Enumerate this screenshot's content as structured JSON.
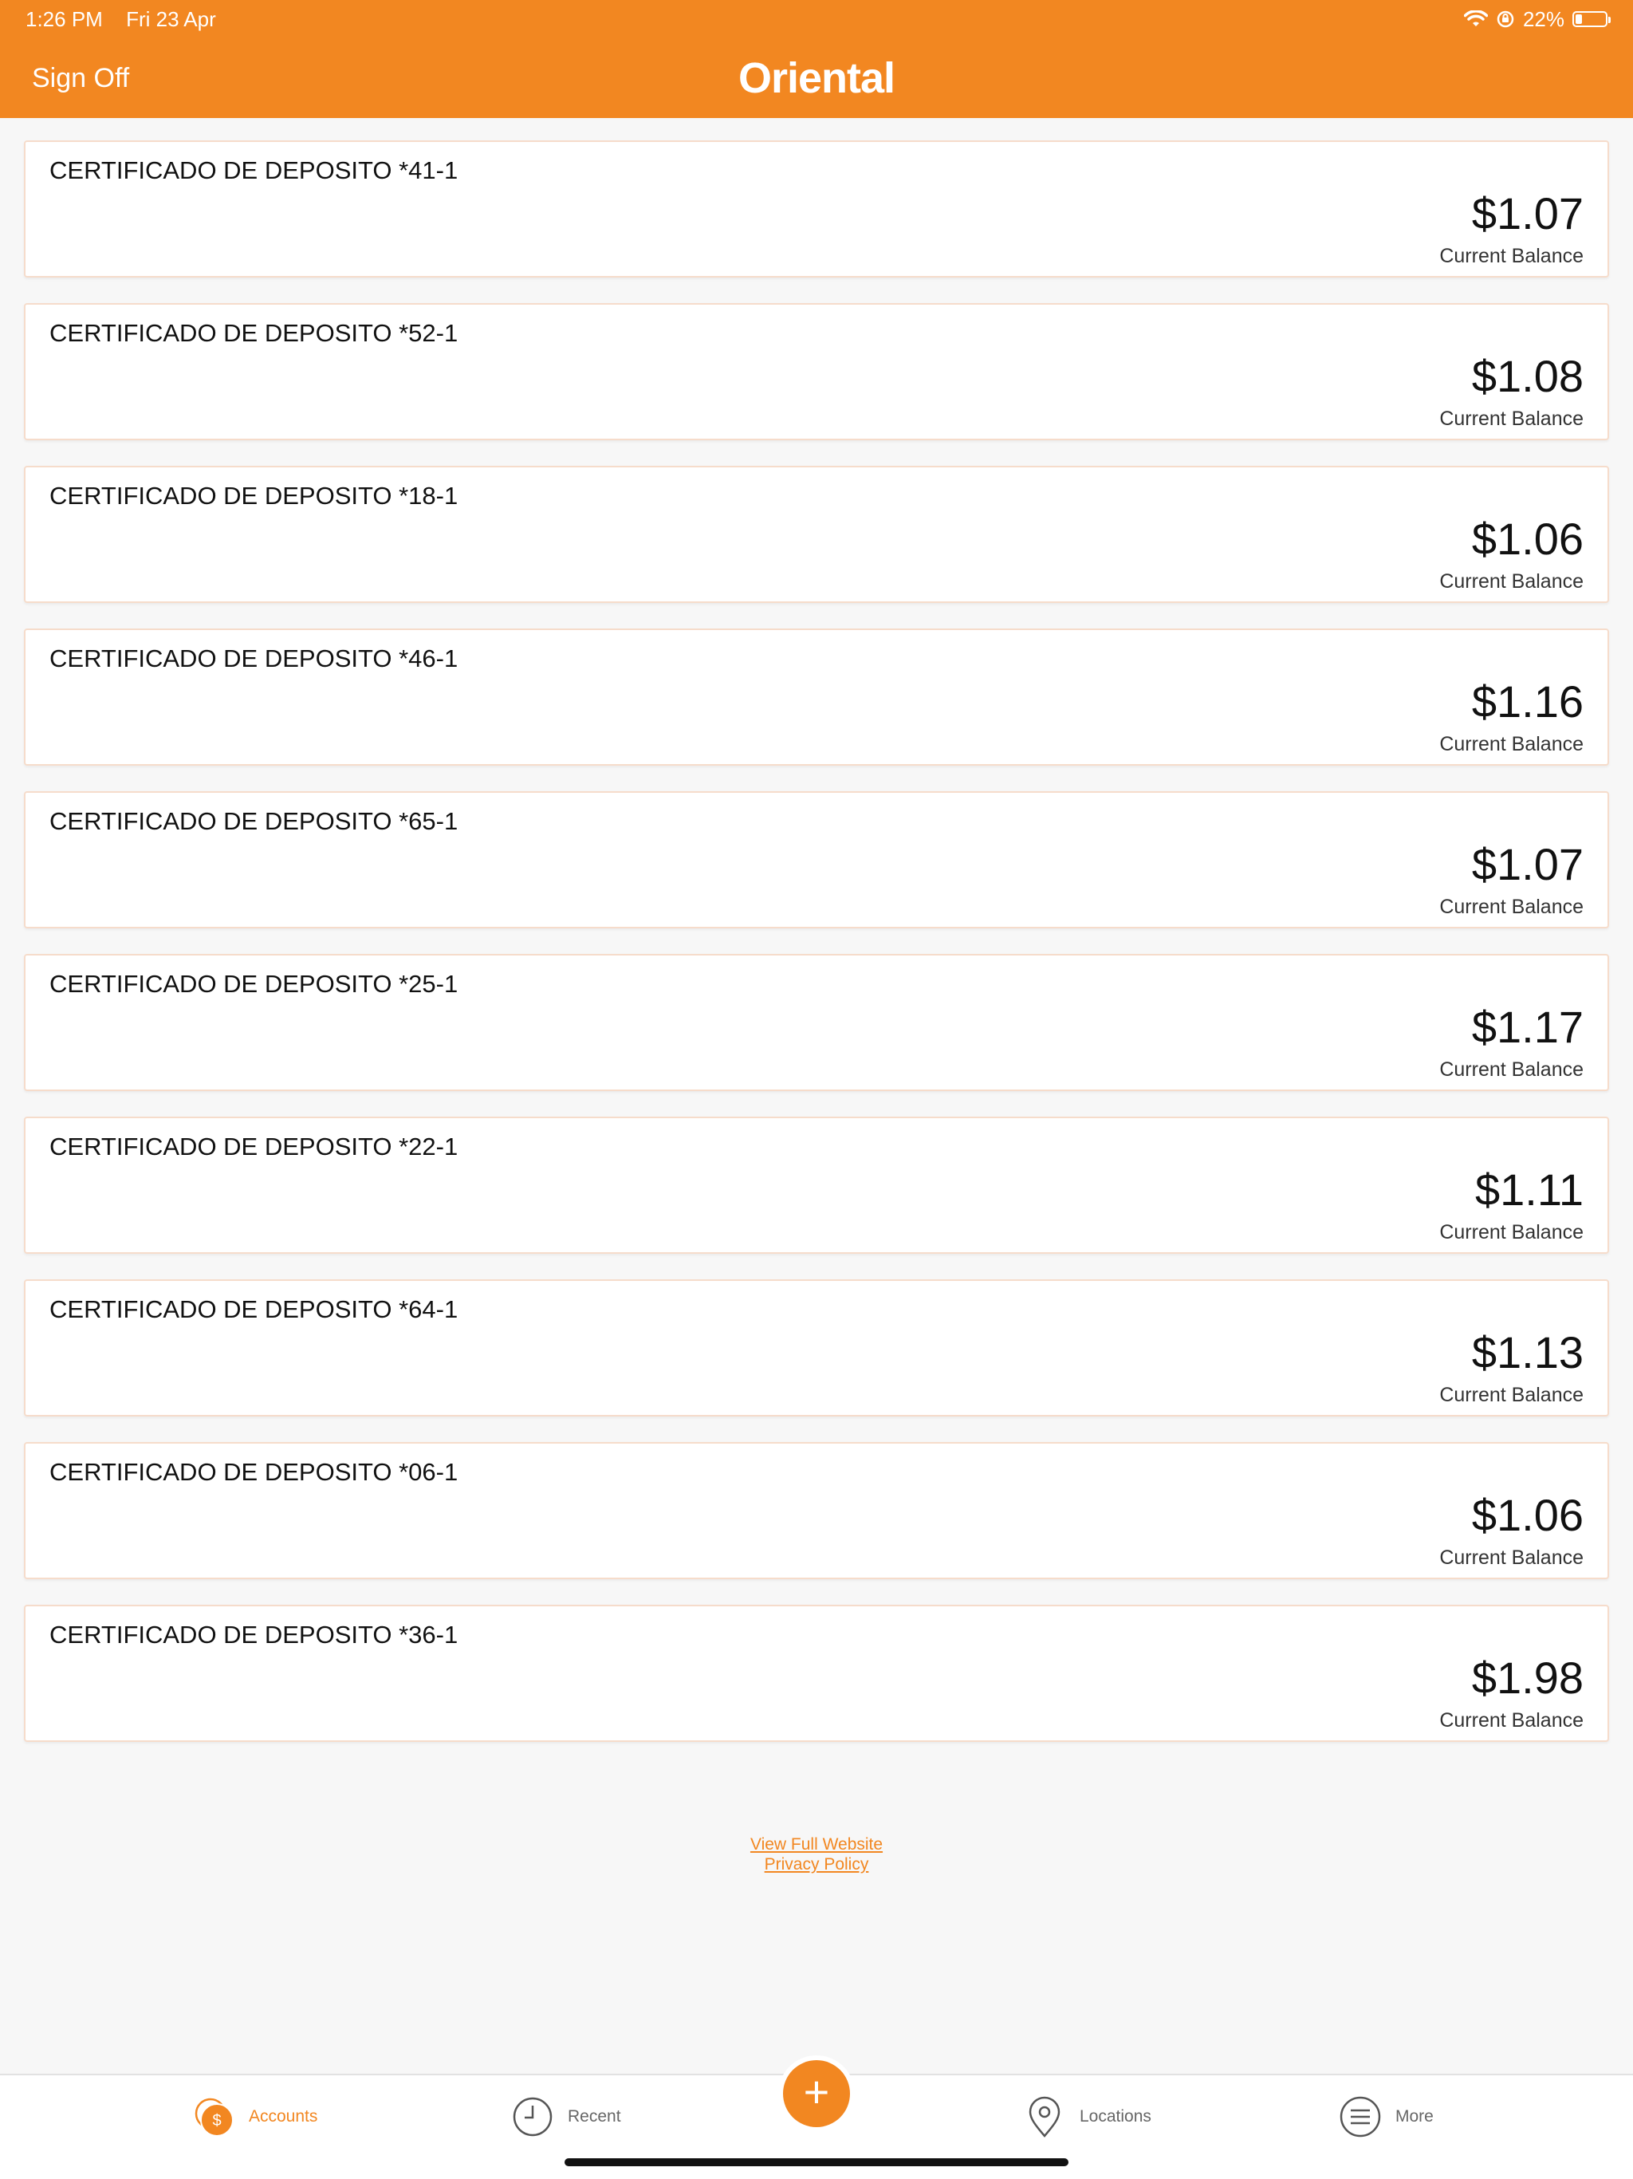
{
  "status_bar": {
    "time": "1:26 PM",
    "date": "Fri 23 Apr",
    "battery": "22%",
    "battery_level": 0.22
  },
  "header": {
    "sign_off_label": "Sign Off",
    "logo_text": "Oriental",
    "accent_color": "#f28721"
  },
  "accounts": [
    {
      "name": "CERTIFICADO DE DEPOSITO *41-1",
      "amount": "$1.07",
      "balance_label": "Current Balance"
    },
    {
      "name": "CERTIFICADO DE DEPOSITO *52-1",
      "amount": "$1.08",
      "balance_label": "Current Balance"
    },
    {
      "name": "CERTIFICADO DE DEPOSITO *18-1",
      "amount": "$1.06",
      "balance_label": "Current Balance"
    },
    {
      "name": "CERTIFICADO DE DEPOSITO *46-1",
      "amount": "$1.16",
      "balance_label": "Current Balance"
    },
    {
      "name": "CERTIFICADO DE DEPOSITO *65-1",
      "amount": "$1.07",
      "balance_label": "Current Balance"
    },
    {
      "name": "CERTIFICADO DE DEPOSITO *25-1",
      "amount": "$1.17",
      "balance_label": "Current Balance"
    },
    {
      "name": "CERTIFICADO DE DEPOSITO *22-1",
      "amount": "$1.11",
      "balance_label": "Current Balance"
    },
    {
      "name": "CERTIFICADO DE DEPOSITO *64-1",
      "amount": "$1.13",
      "balance_label": "Current Balance"
    },
    {
      "name": "CERTIFICADO DE DEPOSITO *06-1",
      "amount": "$1.06",
      "balance_label": "Current Balance"
    },
    {
      "name": "CERTIFICADO DE DEPOSITO *36-1",
      "amount": "$1.98",
      "balance_label": "Current Balance"
    }
  ],
  "footer_links": {
    "full_website": "View Full Website",
    "privacy": "Privacy Policy"
  },
  "tabbar": {
    "accounts": "Accounts",
    "recent": "Recent",
    "add": "+",
    "locations": "Locations",
    "more": "More",
    "accounts_icon_glyph": "$"
  }
}
